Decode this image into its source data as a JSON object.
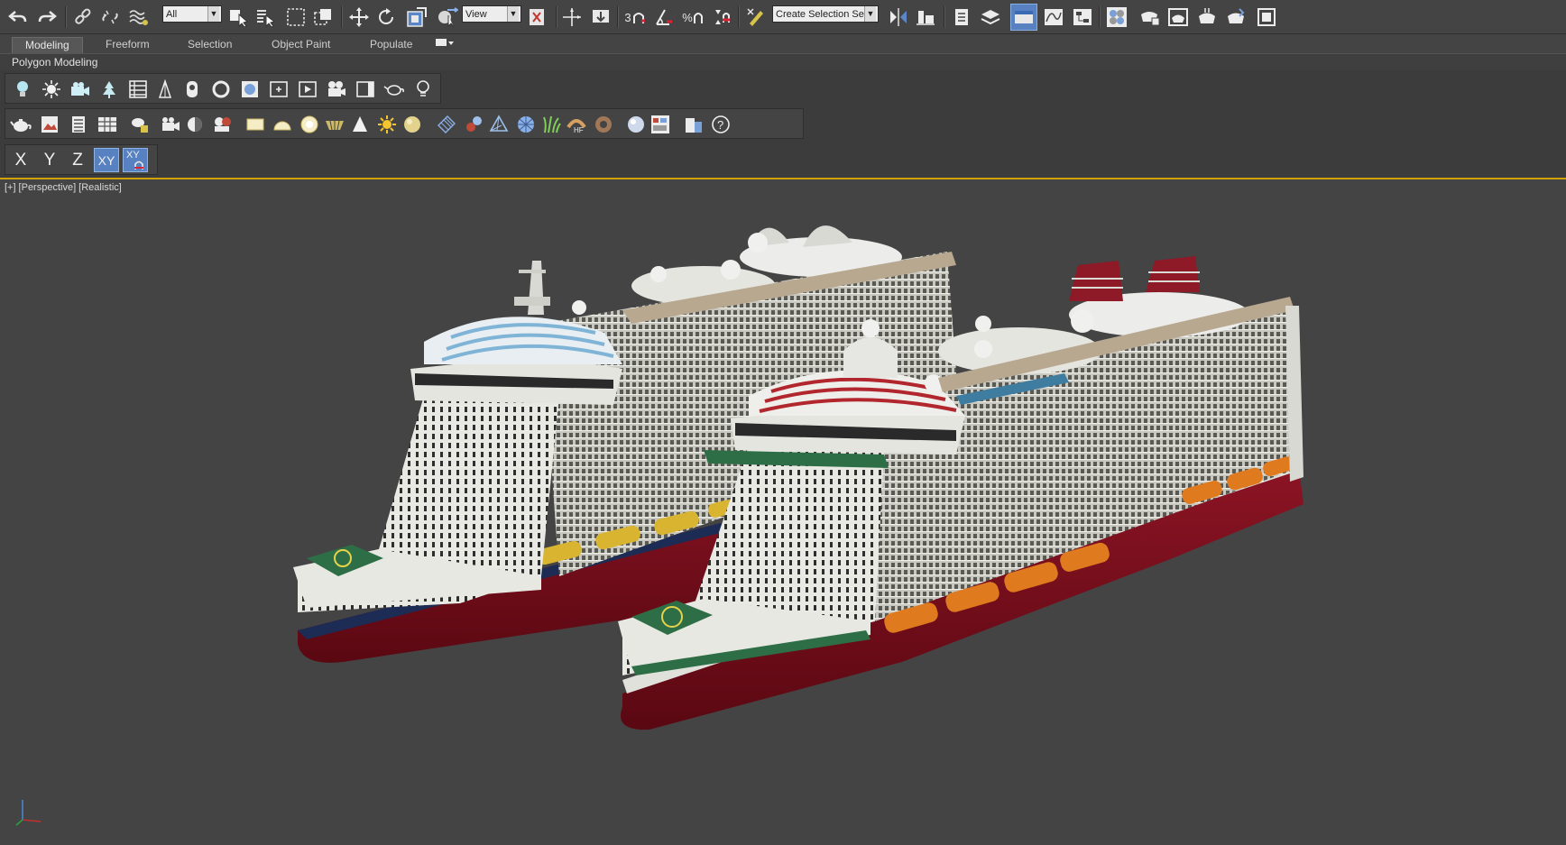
{
  "main_toolbar": {
    "selection_filter": "All",
    "reference_coord": "View",
    "snap_angle_label": "3",
    "percent_snap_label": "%",
    "named_selection": "Create Selection Se"
  },
  "ribbon": {
    "tabs": [
      "Modeling",
      "Freeform",
      "Selection",
      "Object Paint",
      "Populate"
    ],
    "active_tab": "Modeling",
    "panel_label": "Polygon Modeling"
  },
  "axis_constraints": {
    "x": "X",
    "y": "Y",
    "z": "Z",
    "xy": "XY",
    "xy_plane": "XY"
  },
  "viewport": {
    "plus": "[+]",
    "view": "[Perspective]",
    "shading": "[Realistic]"
  },
  "colors": {
    "background": "#444444",
    "active_blue": "#5781c0",
    "viewport_border": "#d0a100",
    "hull_red": "#7a0c1a",
    "lifeboat_orange": "#e07a1e",
    "lifeboat_yellow": "#d8b430"
  },
  "icons": [
    "undo-icon",
    "redo-icon",
    "link-icon",
    "unlink-icon",
    "bind-spacewarp-icon",
    "select-object-icon",
    "select-by-name-icon",
    "rectangle-selection-icon",
    "window-crossing-icon",
    "move-icon",
    "rotate-icon",
    "scale-icon",
    "select-manipulate-icon",
    "mirror-icon",
    "align-icon",
    "help-icon"
  ]
}
